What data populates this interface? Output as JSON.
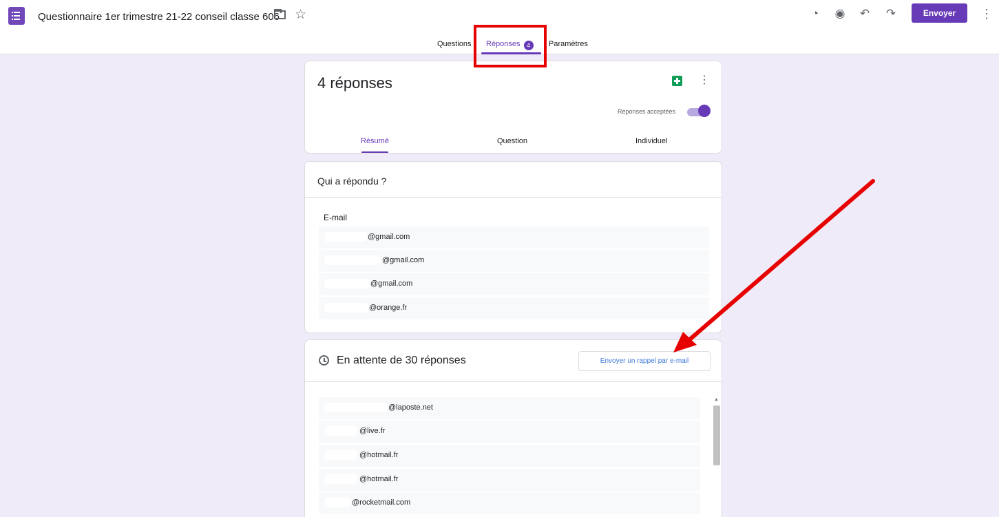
{
  "header": {
    "document_title": "Questionnaire 1er trimestre 21-22 conseil classe 606",
    "send_label": "Envoyer",
    "icons": {
      "app": "google-forms-icon",
      "folder": "folder-icon",
      "star": "star-icon",
      "palette": "palette-icon",
      "preview": "eye-icon",
      "undo": "undo-icon",
      "redo": "redo-icon",
      "more": "more-vertical-icon"
    }
  },
  "tabs": {
    "questions": "Questions",
    "responses": "Réponses",
    "responses_count": "4",
    "settings": "Paramètres"
  },
  "summary": {
    "title": "4 réponses",
    "accepting_label": "Réponses acceptées",
    "accepting_enabled": true,
    "subtabs": [
      "Résumé",
      "Question",
      "Individuel"
    ],
    "active_subtab": "Résumé"
  },
  "who_responded": {
    "title": "Qui a répondu ?",
    "column_label": "E-mail",
    "emails": [
      "@gmail.com",
      "@gmail.com",
      "@gmail.com",
      "@orange.fr"
    ]
  },
  "pending": {
    "title": "En attente de 30 réponses",
    "reminder_button": "Envoyer un rappel par e-mail",
    "emails": [
      "@laposte.net",
      "@live.fr",
      "@hotmail.fr",
      "@hotmail.fr",
      "@rocketmail.com"
    ]
  },
  "colors": {
    "accent": "#673ab7",
    "background": "#f0ebf8",
    "sheets_green": "#0f9d58",
    "annotation_red": "#e60000"
  }
}
